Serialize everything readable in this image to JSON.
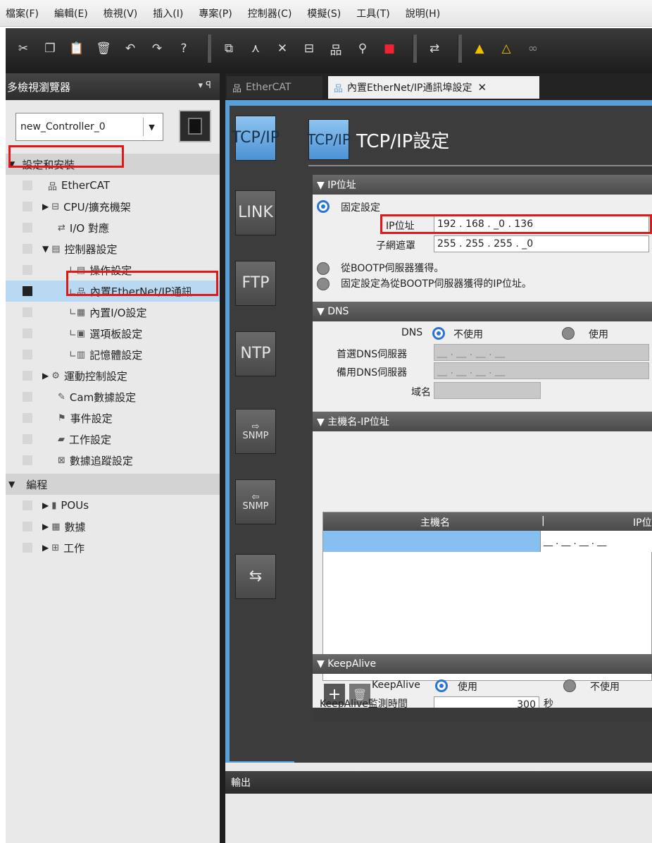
{
  "menu": [
    "檔案(F)",
    "編輯(E)",
    "檢視(V)",
    "插入(I)",
    "專案(P)",
    "控制器(C)",
    "模擬(S)",
    "工具(T)",
    "說明(H)"
  ],
  "left_panel": {
    "title": "多檢視瀏覽器",
    "pin": "▾ ꟼ",
    "controller": "new_Controller_0",
    "tree": [
      {
        "label": "設定和安裝",
        "type": "section"
      },
      {
        "label": "EtherCAT"
      },
      {
        "label": "CPU/擴充機架"
      },
      {
        "label": "I/O 對應"
      },
      {
        "label": "控制器設定"
      },
      {
        "label": "操作設定"
      },
      {
        "label": "內置EtherNet/IP通訊"
      },
      {
        "label": "內置I/O設定"
      },
      {
        "label": "選項板設定"
      },
      {
        "label": "記憶體設定"
      },
      {
        "label": "運動控制設定"
      },
      {
        "label": "Cam數據設定"
      },
      {
        "label": "事件設定"
      },
      {
        "label": "工作設定"
      },
      {
        "label": "數據追蹤設定"
      },
      {
        "label": "編程",
        "type": "section"
      },
      {
        "label": "POUs"
      },
      {
        "label": "數據"
      },
      {
        "label": "工作"
      }
    ]
  },
  "tabs": [
    {
      "label": "EtherCAT",
      "icon": "ethercat-icon"
    },
    {
      "label": "內置EtherNet/IP通訊埠設定",
      "icon": "network-icon"
    }
  ],
  "side_buttons": [
    "TCP/IP",
    "LINK",
    "FTP",
    "NTP",
    "SNMP",
    "SNMP"
  ],
  "panel_title": "TCP/IP設定",
  "panel_icon": "TCP/IP",
  "ip_section": {
    "header": "▼ IP位址",
    "fixed": "固定設定",
    "ip_label": "IP位址",
    "ip_value": "192 . 168 . _0 . 136",
    "mask_label": "子網遮罩",
    "mask_value": "255 . 255 . 255 . _0",
    "bootp": "從BOOTP伺服器獲得。",
    "bootp_fixed": "固定設定為從BOOTP伺服器獲得的IP位址。"
  },
  "dns_section": {
    "header": "▼ DNS",
    "dns_label": "DNS",
    "not_use": "不使用",
    "use": "使用",
    "primary": "首選DNS伺服器",
    "secondary": "備用DNS伺服器",
    "domain": "域名",
    "empty_ip": "__ . __ . __ . __"
  },
  "host_section": {
    "header": "▼ 主機名-IP位址",
    "col_host": "主機名",
    "col_ip": "IP位",
    "row_ip": "__ . __ . __ . __"
  },
  "keepalive_section": {
    "header": "▼ KeepAlive",
    "label": "KeepAlive",
    "use": "使用",
    "not_use": "不使用",
    "monitor_label": "KeepAlive監測時間",
    "monitor_value": "300",
    "unit": "秒"
  },
  "output_title": "輸出"
}
